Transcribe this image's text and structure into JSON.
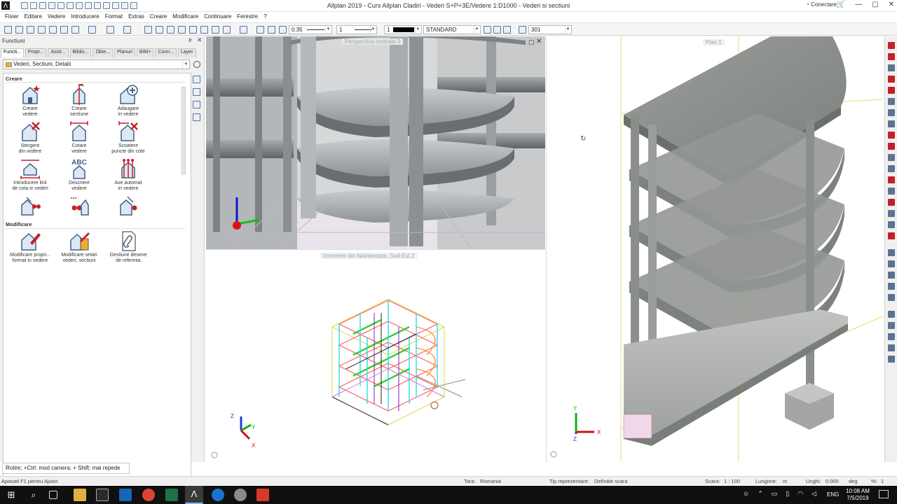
{
  "app": {
    "title": "Allplan 2019 - Curs Allplan Cladiri - Vederi S+P+3E/Vedere 1:D1000 - Vederi si sectiuni",
    "connect": "Conectare",
    "logo": "Λ"
  },
  "menu": [
    "Fisier",
    "Editare",
    "Vedere",
    "Introducere",
    "Format",
    "Extras",
    "Creare",
    "Modificare",
    "Continuare",
    "Ferestre",
    "?"
  ],
  "toolbar": {
    "pen_thickness": "0.35",
    "line_type": "1",
    "color": "1",
    "layer": "STANDARD",
    "scale": "301"
  },
  "palette": {
    "title": "Functiuni",
    "pin": "#",
    "close": "✕",
    "tabs": [
      "Functi...",
      "Propr...",
      "Asist...",
      "Biblio...",
      "Obie...",
      "Planuri",
      "BIM+",
      "Conn...",
      "Layer"
    ],
    "category": "Vederi, Sectiuni, Detalii",
    "section_create": "Creare",
    "section_modify": "Modificare",
    "create_tools": [
      {
        "line1": "Creare",
        "line2": "vedere",
        "icon": "house-star-icon"
      },
      {
        "line1": "Creare",
        "line2": "sectiune",
        "icon": "section-arrows-icon"
      },
      {
        "line1": "Adaugare",
        "line2": "in vedere",
        "icon": "house-plus-icon"
      },
      {
        "line1": "Stergere",
        "line2": "din vedere",
        "icon": "house-delete-icon"
      },
      {
        "line1": "Cotare",
        "line2": "vedere",
        "icon": "house-dimension-icon"
      },
      {
        "line1": "Scoatere",
        "line2": "puncte din cote",
        "icon": "house-remove-points-icon"
      },
      {
        "line1": "Introducere linii",
        "line2": "de cota in vederi",
        "icon": "dimension-lines-icon"
      },
      {
        "line1": "Descriere",
        "line2": "vedere",
        "icon": "abc-label-icon"
      },
      {
        "line1": "Axe automat",
        "line2": "in vedere",
        "icon": "auto-axes-icon"
      },
      {
        "line1": "",
        "line2": "",
        "icon": "house-dots-icon"
      },
      {
        "line1": "",
        "line2": "",
        "icon": "dots-arrow-icon"
      },
      {
        "line1": "",
        "line2": "",
        "icon": "house-arrow-icon"
      }
    ],
    "create_text_label": "ABC",
    "modify_tools": [
      {
        "line1": "Modificare propri...",
        "line2": "format in vedere",
        "icon": "house-pen-icon"
      },
      {
        "line1": "Modificare setari",
        "line2": "vederi, sectiuni",
        "icon": "settings-grid-icon"
      },
      {
        "line1": "Gestiune desene",
        "line2": "de referinta",
        "icon": "paperclip-doc-icon"
      }
    ]
  },
  "viewports": {
    "perspective": {
      "label": "Perspectiva centrala 3"
    },
    "isometric": {
      "label": "Izometrie din fata/dreapta, Sud-Est 2"
    },
    "plan": {
      "label": "Plan 1"
    },
    "axes": {
      "x": "X",
      "y": "Y",
      "z": "Z"
    }
  },
  "hint": "Rotire; +Ctrl: mod camera; + Shift: mai repede",
  "status": {
    "help": "Apasati F1 pentru Ajutor.",
    "country_label": "Tara:",
    "country": "Romania",
    "repr_label": "Tip reprezentare:",
    "repr": "Definitie scara",
    "scale_label": "Scara:",
    "scale": "1 : 100",
    "length_label": "Lungime:",
    "length": "m",
    "angle_label": "Unghi:",
    "angle": "0.000",
    "angle_unit": "deg",
    "percent_label": "%:",
    "percent": "1"
  },
  "taskbar": {
    "time": "10:08 AM",
    "date": "7/5/2019",
    "lang": "ENG"
  }
}
